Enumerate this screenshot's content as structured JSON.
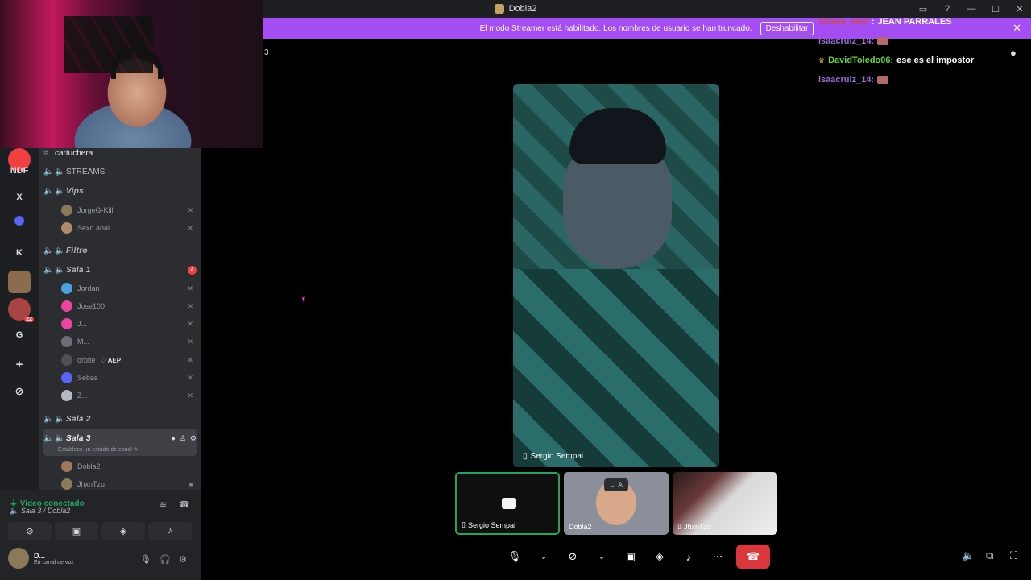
{
  "window": {
    "title": "Dobla2"
  },
  "banner": {
    "text": "El modo Streamer está habilitado. Los nombres de usuario se han truncado.",
    "button": "Deshabilitar",
    "close": "✕"
  },
  "page_num": "3",
  "rail": {
    "items": [
      "NDF",
      "X",
      "K",
      "G"
    ],
    "badge": "22"
  },
  "channels": {
    "text_channel": "cartuchera",
    "streams": "STREAMS",
    "vips": "Vips",
    "vip_members": [
      "JorgeG-Kill",
      "Sexo anal"
    ],
    "filtro": "Filtro",
    "sala1": "Sala 1",
    "sala1_badge": "4",
    "sala1_members": [
      "Jordan",
      "Jose100",
      "J...",
      "M...",
      "orbite",
      "Sebas",
      "Z..."
    ],
    "orbite_tag": "AEP",
    "sala2": "Sala 2",
    "sala3": "Sala 3",
    "sala3_status": "Establece un estado de canal",
    "sala3_members": [
      "Dobla2",
      "JhxnTzu"
    ]
  },
  "voice": {
    "status": "Video conectado",
    "location": "Sala 3 / Dobla2",
    "user": "D...",
    "user_status": "En canal de voz"
  },
  "main_video": {
    "label": "Sergio Sempai"
  },
  "chat": [
    {
      "user": "Sirana_xixo",
      "text": "JEAN PARRALES"
    },
    {
      "user": "isaacruiz_14:",
      "text": ""
    },
    {
      "user": "DavidToledo06:",
      "text": "ese es el impostor"
    },
    {
      "user": "isaacruiz_14:",
      "text": ""
    }
  ],
  "thumbs": [
    {
      "label": "Sergio Sempai"
    },
    {
      "label": "Dobla2"
    },
    {
      "label": "JhxnTzu"
    }
  ],
  "colors": {
    "banner": "#a34df2",
    "hangup": "#da373c",
    "connected": "#23a55a",
    "sidebar": "#2b2d31"
  }
}
